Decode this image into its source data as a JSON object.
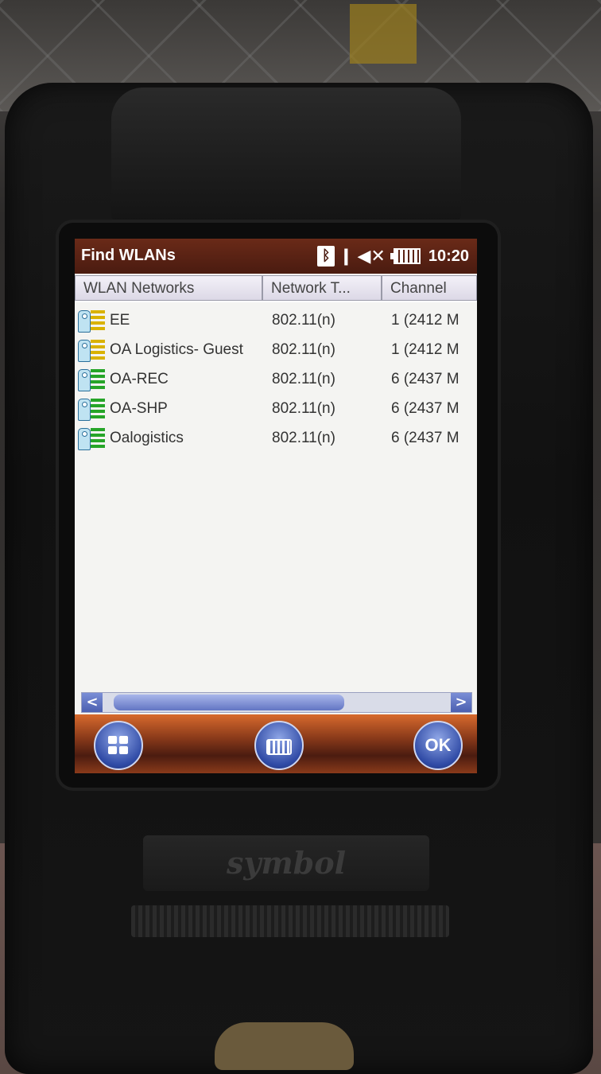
{
  "window": {
    "title": "Find WLANs",
    "clock": "10:20"
  },
  "status_icons": [
    "bluetooth-icon",
    "antenna-icon",
    "speaker-muted-icon",
    "battery-icon"
  ],
  "list": {
    "columns": [
      "WLAN Networks",
      "Network T...",
      "Channel"
    ],
    "rows": [
      {
        "name": "EE",
        "type": "802.11(n)",
        "channel": "1 (2412 M",
        "signal": "yellow"
      },
      {
        "name": "OA Logistics- Guest",
        "type": "802.11(n)",
        "channel": "1 (2412 M",
        "signal": "yellow"
      },
      {
        "name": "OA-REC",
        "type": "802.11(n)",
        "channel": "6 (2437 M",
        "signal": "green"
      },
      {
        "name": "OA-SHP",
        "type": "802.11(n)",
        "channel": "6 (2437 M",
        "signal": "green"
      },
      {
        "name": "Oalogistics",
        "type": "802.11(n)",
        "channel": "6 (2437 M",
        "signal": "green"
      }
    ]
  },
  "scrollbar": {
    "left_arrow": "<",
    "right_arrow": ">"
  },
  "bottom_bar": {
    "ok_label": "OK"
  },
  "device": {
    "brand": "symbol"
  },
  "colors": {
    "titlebar": "#5a2214",
    "signal_yellow": "#d9b200",
    "signal_green": "#26a528",
    "button_blue": "#2f4aa5"
  }
}
